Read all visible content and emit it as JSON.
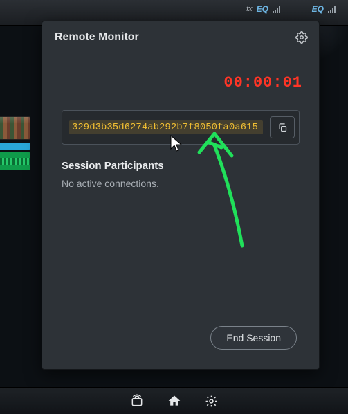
{
  "topbar": {
    "fx_label": "fx",
    "eq_label": "EQ"
  },
  "panel": {
    "title": "Remote Monitor",
    "timer": "00:00:01",
    "session_id": "329d3b35d6274ab292b7f8050fa0a615",
    "participants_title": "Session Participants",
    "participants_msg": "No active connections.",
    "end_button": "End Session"
  }
}
